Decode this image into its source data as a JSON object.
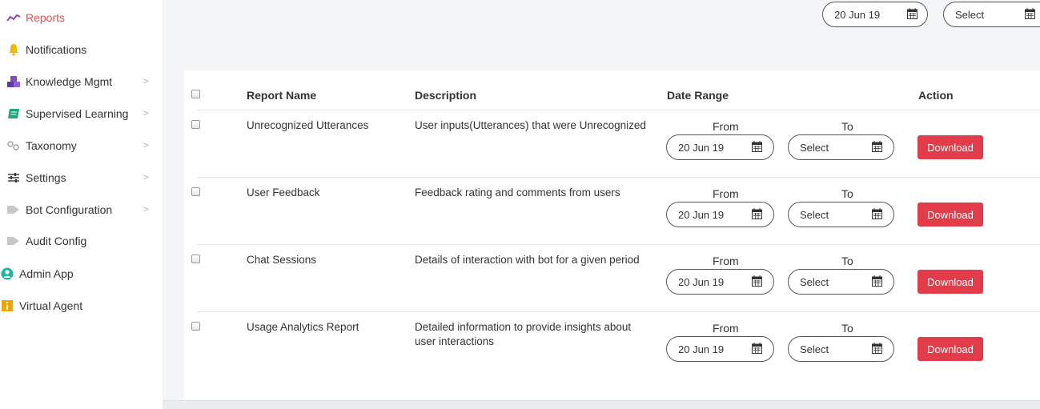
{
  "sidebar": {
    "items": [
      {
        "label": "Reports",
        "icon": "trend-chart-icon",
        "active": true,
        "chevron": false
      },
      {
        "label": "Notifications",
        "icon": "bell-icon",
        "active": false,
        "chevron": false
      },
      {
        "label": "Knowledge Mgmt",
        "icon": "cubes-icon",
        "active": false,
        "chevron": true
      },
      {
        "label": "Supervised Learning",
        "icon": "book-icon",
        "active": false,
        "chevron": true
      },
      {
        "label": "Taxonomy",
        "icon": "link-icon",
        "active": false,
        "chevron": true
      },
      {
        "label": "Settings",
        "icon": "sliders-icon",
        "active": false,
        "chevron": true
      },
      {
        "label": "Bot Configuration",
        "icon": "tag-icon",
        "active": false,
        "chevron": true
      },
      {
        "label": "Audit Config",
        "icon": "tag-icon",
        "active": false,
        "chevron": false
      },
      {
        "label": "Admin App",
        "icon": "user-circle-icon",
        "active": false,
        "chevron": false
      },
      {
        "label": "Virtual Agent",
        "icon": "info-square-icon",
        "active": false,
        "chevron": false
      }
    ]
  },
  "topbar": {
    "from_date": "20 Jun 19",
    "to_date": "Select"
  },
  "table": {
    "headers": {
      "name": "Report Name",
      "description": "Description",
      "date_range": "Date Range",
      "action": "Action"
    },
    "from_label": "From",
    "to_label": "To",
    "rows": [
      {
        "name": "Unrecognized Utterances",
        "description": "User inputs(Utterances) that were Unrecognized",
        "from": "20 Jun 19",
        "to": "Select",
        "action": "Download"
      },
      {
        "name": "User Feedback",
        "description": "Feedback rating and comments from users",
        "from": "20 Jun 19",
        "to": "Select",
        "action": "Download"
      },
      {
        "name": "Chat Sessions",
        "description": "Details of interaction with bot for a given period",
        "from": "20 Jun 19",
        "to": "Select",
        "action": "Download"
      },
      {
        "name": "Usage Analytics Report",
        "description": "Detailed information to provide insights about user interactions",
        "from": "20 Jun 19",
        "to": "Select",
        "action": "Download"
      }
    ]
  },
  "colors": {
    "accent": "#e8505b",
    "button": "#e23b4a",
    "icon_gray": "#aaaaaa"
  }
}
